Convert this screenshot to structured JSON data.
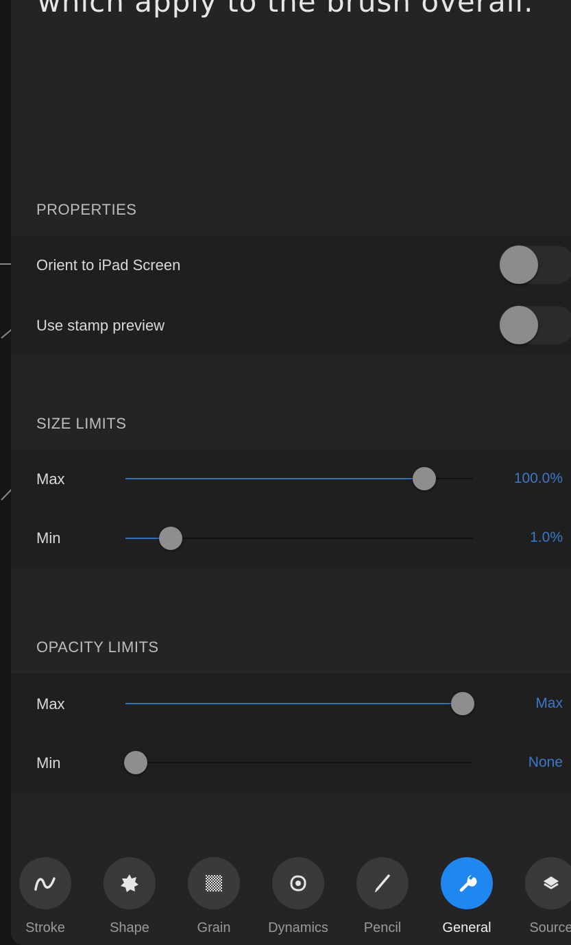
{
  "caption": "which apply to the brush overall.",
  "properties": {
    "title": "PROPERTIES",
    "rows": [
      {
        "label": "Orient to iPad Screen",
        "on": false
      },
      {
        "label": "Use stamp preview",
        "on": false
      }
    ]
  },
  "size_limits": {
    "title": "SIZE LIMITS",
    "rows": [
      {
        "label": "Max",
        "value": "100.0%",
        "level": 0.86
      },
      {
        "label": "Min",
        "value": "1.0%",
        "level": 0.13
      }
    ]
  },
  "opacity_limits": {
    "title": "OPACITY LIMITS",
    "rows": [
      {
        "label": "Max",
        "value": "Max",
        "level": 0.97
      },
      {
        "label": "Min",
        "value": "None",
        "level": 0.03
      }
    ]
  },
  "tabs": [
    {
      "label": "Stroke",
      "icon": "stroke-wave-icon",
      "active": false
    },
    {
      "label": "Shape",
      "icon": "shape-flower-icon",
      "active": false
    },
    {
      "label": "Grain",
      "icon": "grain-texture-icon",
      "active": false
    },
    {
      "label": "Dynamics",
      "icon": "dynamics-swirl-icon",
      "active": false
    },
    {
      "label": "Pencil",
      "icon": "pencil-icon",
      "active": false
    },
    {
      "label": "General",
      "icon": "wrench-icon",
      "active": true
    },
    {
      "label": "Source",
      "icon": "layers-icon",
      "active": false
    }
  ],
  "colors": {
    "accent": "#1e88f0",
    "value_text": "#3d78c9"
  }
}
